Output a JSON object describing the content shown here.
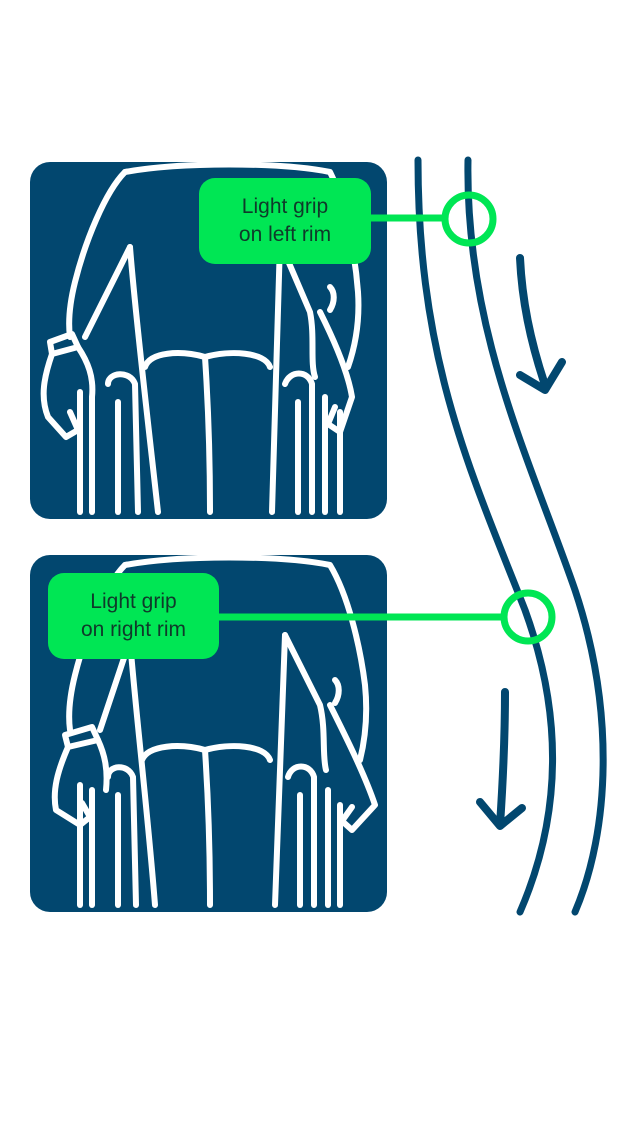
{
  "colors": {
    "panel_bg": "#02476f",
    "figure_stroke": "#ffffff",
    "callout_bg": "#00e654",
    "callout_text": "#0f3a2a",
    "rim_stroke": "#02476f",
    "marker_stroke": "#00e654"
  },
  "icons": {
    "top_panel": "wheelchair-user-back-view-icon",
    "bottom_panel": "wheelchair-user-back-view-icon",
    "arrows": "direction-arrow-down-icon"
  },
  "callouts": {
    "left_rim": {
      "line1": "Light grip",
      "line2": "on left rim"
    },
    "right_rim": {
      "line1": "Light grip",
      "line2": "on right rim"
    }
  }
}
